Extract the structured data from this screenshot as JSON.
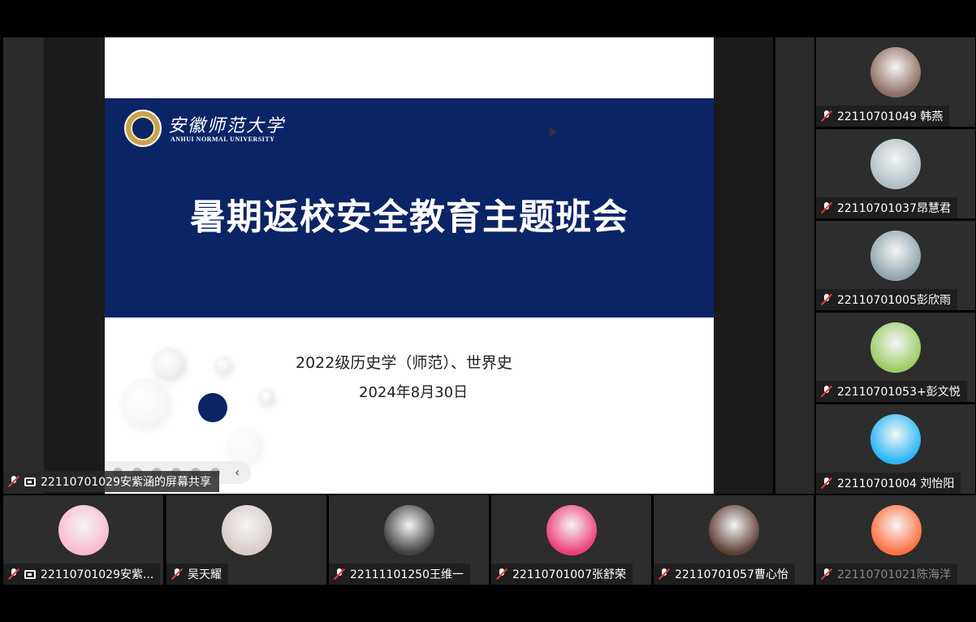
{
  "shared_screen": {
    "slide": {
      "university_cn": "安徽师范大学",
      "university_en": "ANHUI NORMAL UNIVERSITY",
      "title": "暑期返校安全教育主题班会",
      "subtitle": "2022级历史学（师范）、世界史",
      "date": "2024年8月30日"
    },
    "share_label": "22110701029安紫涵的屏幕共享"
  },
  "right_column": [
    {
      "name": "22110701049  韩燕",
      "avatar_icon": "avatar-icon",
      "avatar_color": "#8d6e63"
    },
    {
      "name": "22110701037昂慧君",
      "avatar_icon": "avatar-icon",
      "avatar_color": "#b0bec5"
    },
    {
      "name": "22110701005彭欣雨",
      "avatar_icon": "avatar-icon",
      "avatar_color": "#90a4ae"
    },
    {
      "name": "22110701053+彭文悦",
      "avatar_icon": "avatar-icon",
      "avatar_color": "#9ccc65"
    },
    {
      "name": "22110701004  刘怡阳",
      "avatar_icon": "avatar-icon",
      "avatar_color": "#29b6f6"
    }
  ],
  "bottom_row": [
    {
      "name": "22110701029安紫...",
      "icon": "screen-share-icon",
      "avatar_color": "#f8bbd0"
    },
    {
      "name": "吴天耀",
      "avatar_color": "#d7ccc8"
    },
    {
      "name": "22111101250王维一",
      "avatar_color": "#424242"
    },
    {
      "name": "22110701007张舒荣",
      "avatar_color": "#ec407a"
    },
    {
      "name": "22110701057曹心怡",
      "avatar_color": "#5d4037"
    },
    {
      "name": "22110701021陈海洋",
      "avatar_color": "#ff7043"
    }
  ]
}
